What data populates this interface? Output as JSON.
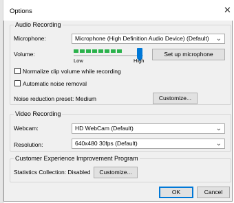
{
  "dialog": {
    "title": "Options",
    "close_glyph": "✕"
  },
  "audio": {
    "group_label": "Audio Recording",
    "microphone_label": "Microphone:",
    "microphone_value": "Microphone (High Definition Audio Device) (Default)",
    "volume_label": "Volume:",
    "volume_low": "Low",
    "volume_high": "High",
    "volume_level": 0.85,
    "meter_segments_lit": 8,
    "setup_button": "Set up microphone",
    "normalize_label": "Normalize clip volume while recording",
    "normalize_checked": false,
    "noise_removal_label": "Automatic noise removal",
    "noise_removal_checked": false,
    "noise_preset_label": "Noise reduction preset: Medium",
    "customize_button": "Customize..."
  },
  "video": {
    "group_label": "Video Recording",
    "webcam_label": "Webcam:",
    "webcam_value": "HD WebCam (Default)",
    "resolution_label": "Resolution:",
    "resolution_value": "640x480 30fps (Default)"
  },
  "ceip": {
    "group_label": "Customer Experience Improvement Program",
    "stats_label": "Statistics Collection: Disabled",
    "customize_button": "Customize..."
  },
  "footer": {
    "ok_button": "OK",
    "cancel_button": "Cancel"
  },
  "icons": {
    "chevron": "chevron-down-icon",
    "close": "close-icon"
  },
  "colors": {
    "accent": "#0078d7",
    "meter": "#2bb24c"
  }
}
